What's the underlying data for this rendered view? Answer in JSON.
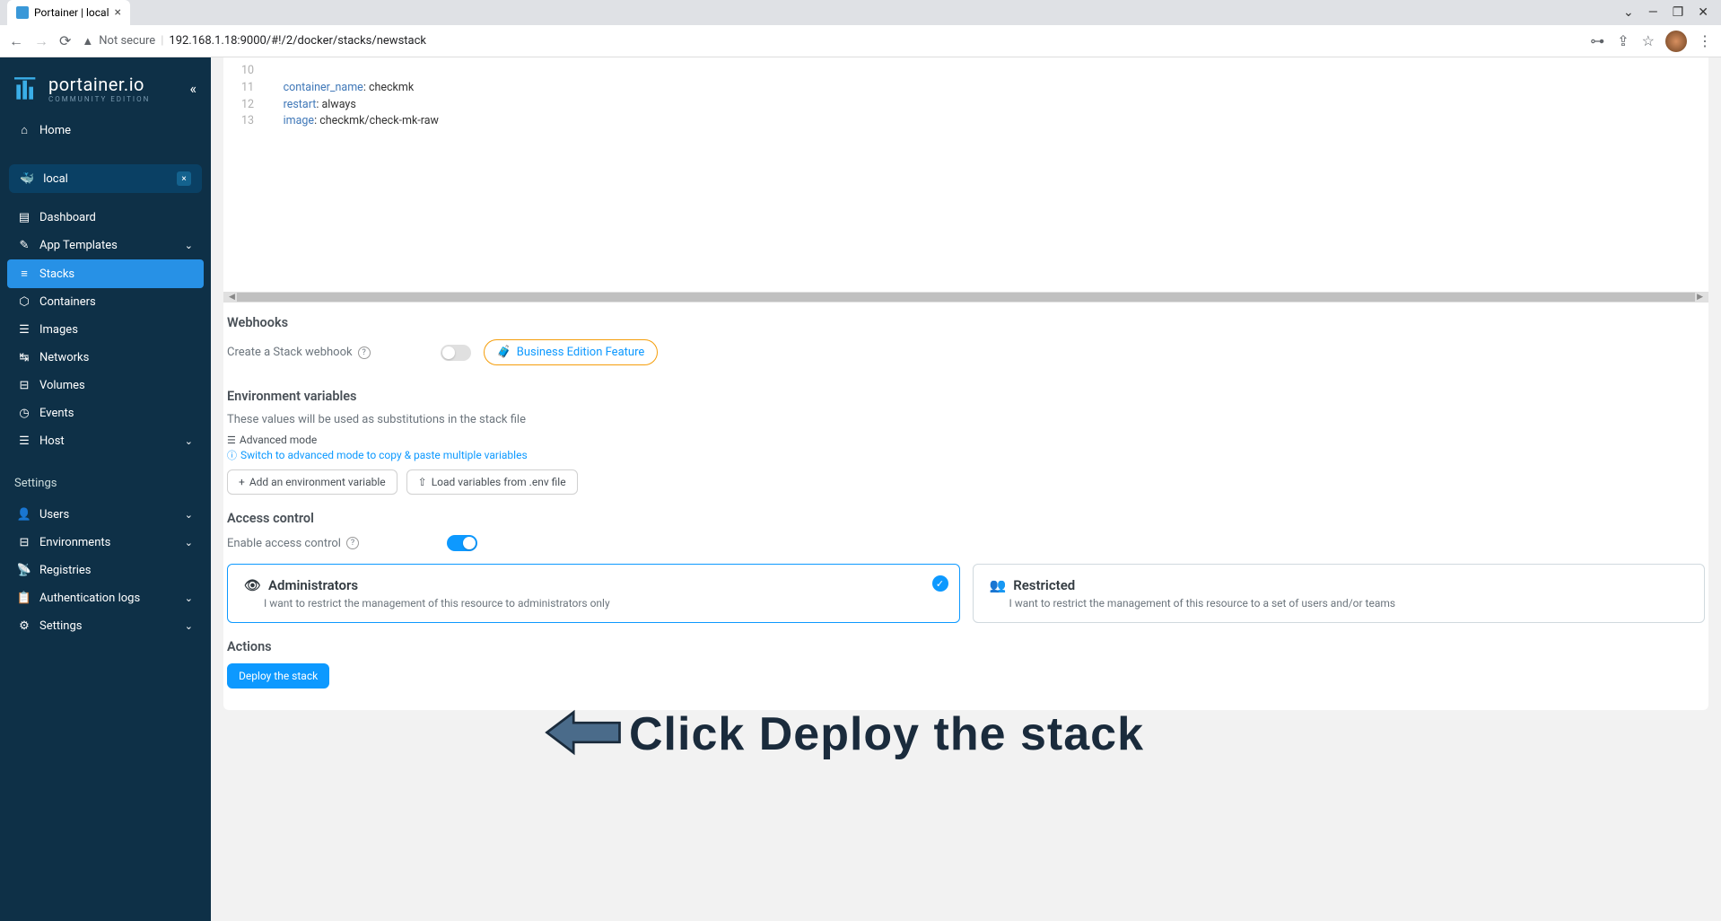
{
  "browser": {
    "tab_title": "Portainer | local",
    "url_prefix": "Not secure",
    "url": "192.168.1.18:9000/#!/2/docker/stacks/newstack"
  },
  "sidebar": {
    "logo_title": "portainer.io",
    "logo_sub": "COMMUNITY EDITION",
    "home": "Home",
    "env_name": "local",
    "items": [
      {
        "label": "Dashboard",
        "icon": "▤"
      },
      {
        "label": "App Templates",
        "icon": "✎",
        "chevron": true
      },
      {
        "label": "Stacks",
        "icon": "≡",
        "active": true
      },
      {
        "label": "Containers",
        "icon": "⬡"
      },
      {
        "label": "Images",
        "icon": "☰"
      },
      {
        "label": "Networks",
        "icon": "↹"
      },
      {
        "label": "Volumes",
        "icon": "⊟"
      },
      {
        "label": "Events",
        "icon": "◷"
      },
      {
        "label": "Host",
        "icon": "☰",
        "chevron": true
      }
    ],
    "settings_label": "Settings",
    "settings_items": [
      {
        "label": "Users",
        "icon": "👤",
        "chevron": true
      },
      {
        "label": "Environments",
        "icon": "⊟",
        "chevron": true
      },
      {
        "label": "Registries",
        "icon": "📡"
      },
      {
        "label": "Authentication logs",
        "icon": "📋",
        "chevron": true
      },
      {
        "label": "Settings",
        "icon": "⚙",
        "chevron": true
      }
    ]
  },
  "editor": {
    "lines": [
      {
        "n": "10",
        "indent": "      ",
        "text": ""
      },
      {
        "n": "11",
        "indent": "      ",
        "key": "container_name",
        "val": "checkmk"
      },
      {
        "n": "12",
        "indent": "      ",
        "key": "restart",
        "val": "always"
      },
      {
        "n": "13",
        "indent": "      ",
        "key": "image",
        "val": "checkmk/check-mk-raw"
      }
    ]
  },
  "webhooks": {
    "title": "Webhooks",
    "create_label": "Create a Stack webhook",
    "be_feature": "Business Edition Feature"
  },
  "env_vars": {
    "title": "Environment variables",
    "desc": "These values will be used as substitutions in the stack file",
    "advanced": "Advanced mode",
    "switch_hint": "Switch to advanced mode to copy & paste multiple variables",
    "add_btn": "Add an environment variable",
    "load_btn": "Load variables from .env file"
  },
  "access": {
    "title": "Access control",
    "enable_label": "Enable access control",
    "cards": [
      {
        "title": "Administrators",
        "desc": "I want to restrict the management of this resource to administrators only",
        "selected": true
      },
      {
        "title": "Restricted",
        "desc": "I want to restrict the management of this resource to a set of users and/or teams",
        "selected": false
      }
    ]
  },
  "actions": {
    "title": "Actions",
    "deploy_btn": "Deploy the stack"
  },
  "annotation": "Click Deploy the stack"
}
